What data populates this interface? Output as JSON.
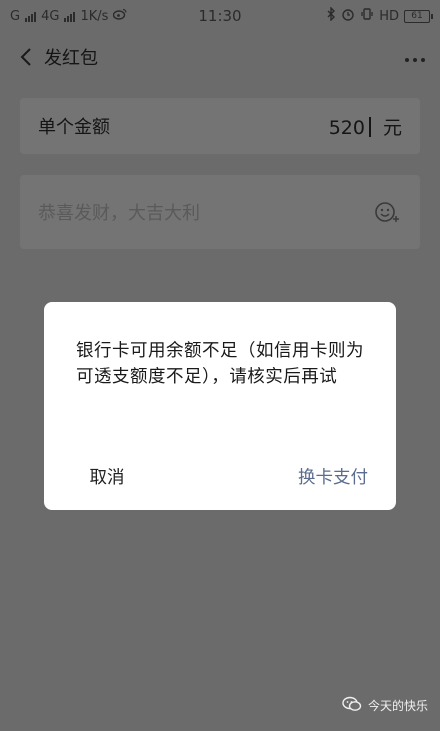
{
  "status": {
    "left_carrier1": "G",
    "left_carrier2": "4G",
    "speed": "1K/s",
    "time": "11:30",
    "hd": "HD",
    "battery": "61"
  },
  "header": {
    "title": "发红包"
  },
  "amount": {
    "label": "单个金额",
    "value": "520",
    "unit": "元"
  },
  "greeting": {
    "placeholder": "恭喜发财，大吉大利"
  },
  "dialog": {
    "message": "银行卡可用余额不足（如信用卡则为可透支额度不足），请核实后再试",
    "cancel": "取消",
    "confirm": "换卡支付"
  },
  "watermark": {
    "text": "今天的快乐"
  },
  "icons": [
    "signal-icon",
    "weibo-icon",
    "bluetooth-icon",
    "alarm-icon",
    "vibrate-icon",
    "battery-icon",
    "back-icon",
    "more-icon",
    "emoji-icon",
    "wechat-icon"
  ]
}
